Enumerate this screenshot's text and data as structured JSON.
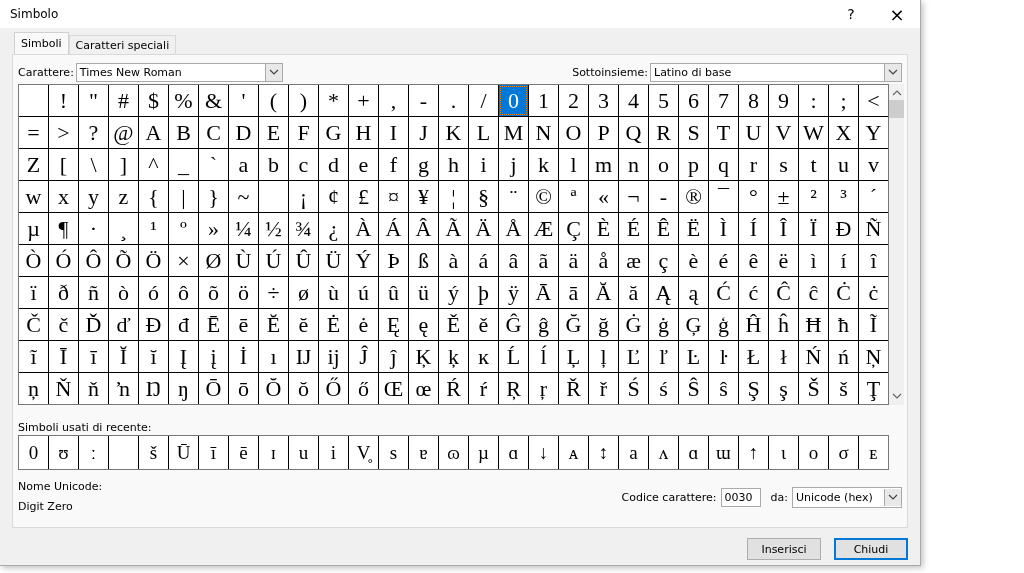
{
  "window": {
    "title": "Simbolo",
    "help": "?",
    "close": "×"
  },
  "tabs": [
    {
      "label": "Simboli",
      "selected": true
    },
    {
      "label": "Caratteri speciali",
      "selected": false
    }
  ],
  "font": {
    "label": "Carattere:",
    "value": "Times New Roman"
  },
  "subset": {
    "label": "Sottoinsieme:",
    "value": "Latino di base"
  },
  "grid": {
    "rows": [
      [
        {
          "selected": false
        },
        {
          "c": "!",
          "selected": false
        },
        {
          "c": "\"",
          "selected": false
        },
        {
          "c": "#",
          "selected": false
        },
        {
          "c": "$",
          "selected": false
        },
        {
          "c": "%",
          "selected": false
        },
        {
          "c": "&",
          "selected": false
        },
        {
          "c": "'",
          "selected": false
        },
        {
          "c": "(",
          "selected": false
        },
        {
          "c": ")",
          "selected": false
        },
        {
          "c": "*",
          "selected": false
        },
        {
          "c": "+",
          "selected": false
        },
        {
          "c": ",",
          "selected": false
        },
        {
          "c": "-",
          "selected": false
        },
        {
          "c": ".",
          "selected": false
        },
        {
          "c": "/",
          "selected": false
        },
        {
          "c": "0",
          "selected": true
        },
        {
          "c": "1",
          "selected": false
        },
        {
          "c": "2",
          "selected": false
        },
        {
          "c": "3",
          "selected": false
        },
        {
          "c": "4",
          "selected": false
        },
        {
          "c": "5",
          "selected": false
        },
        {
          "c": "6",
          "selected": false
        },
        {
          "c": "7",
          "selected": false
        },
        {
          "c": "8",
          "selected": false
        },
        {
          "c": "9",
          "selected": false
        },
        {
          "c": ":",
          "selected": false
        },
        {
          "c": ";",
          "selected": false
        },
        {
          "c": "<",
          "selected": false
        }
      ],
      [
        {
          "c": "=",
          "selected": false
        },
        {
          "c": ">",
          "selected": false
        },
        {
          "c": "?",
          "selected": false
        },
        {
          "c": "@",
          "selected": false
        },
        {
          "c": "A",
          "selected": false
        },
        {
          "c": "B",
          "selected": false
        },
        {
          "c": "C",
          "selected": false
        },
        {
          "c": "D",
          "selected": false
        },
        {
          "c": "E",
          "selected": false
        },
        {
          "c": "F",
          "selected": false
        },
        {
          "c": "G",
          "selected": false
        },
        {
          "c": "H",
          "selected": false
        },
        {
          "c": "I",
          "selected": false
        },
        {
          "c": "J",
          "selected": false
        },
        {
          "c": "K",
          "selected": false
        },
        {
          "c": "L",
          "selected": false
        },
        {
          "c": "M",
          "selected": false
        },
        {
          "c": "N",
          "selected": false
        },
        {
          "c": "O",
          "selected": false
        },
        {
          "c": "P",
          "selected": false
        },
        {
          "c": "Q",
          "selected": false
        },
        {
          "c": "R",
          "selected": false
        },
        {
          "c": "S",
          "selected": false
        },
        {
          "c": "T",
          "selected": false
        },
        {
          "c": "U",
          "selected": false
        },
        {
          "c": "V",
          "selected": false
        },
        {
          "c": "W",
          "selected": false
        },
        {
          "c": "X",
          "selected": false
        },
        {
          "c": "Y",
          "selected": false
        }
      ],
      [
        {
          "c": "Z",
          "selected": false
        },
        {
          "c": "[",
          "selected": false
        },
        {
          "c": "\\",
          "selected": false
        },
        {
          "c": "]",
          "selected": false
        },
        {
          "c": "^",
          "selected": false
        },
        {
          "c": "_",
          "selected": false
        },
        {
          "c": "`",
          "selected": false
        },
        {
          "c": "a",
          "selected": false
        },
        {
          "c": "b",
          "selected": false
        },
        {
          "c": "c",
          "selected": false
        },
        {
          "c": "d",
          "selected": false
        },
        {
          "c": "e",
          "selected": false
        },
        {
          "c": "f",
          "selected": false
        },
        {
          "c": "g",
          "selected": false
        },
        {
          "c": "h",
          "selected": false
        },
        {
          "c": "i",
          "selected": false
        },
        {
          "c": "j",
          "selected": false
        },
        {
          "c": "k",
          "selected": false
        },
        {
          "c": "l",
          "selected": false
        },
        {
          "c": "m",
          "selected": false
        },
        {
          "c": "n",
          "selected": false
        },
        {
          "c": "o",
          "selected": false
        },
        {
          "c": "p",
          "selected": false
        },
        {
          "c": "q",
          "selected": false
        },
        {
          "c": "r",
          "selected": false
        },
        {
          "c": "s",
          "selected": false
        },
        {
          "c": "t",
          "selected": false
        },
        {
          "c": "u",
          "selected": false
        },
        {
          "c": "v",
          "selected": false
        }
      ],
      [
        {
          "c": "w",
          "selected": false
        },
        {
          "c": "x",
          "selected": false
        },
        {
          "c": "y",
          "selected": false
        },
        {
          "c": "z",
          "selected": false
        },
        {
          "c": "{",
          "selected": false
        },
        {
          "c": "|",
          "selected": false
        },
        {
          "c": "}",
          "selected": false
        },
        {
          "c": "~",
          "selected": false
        },
        {
          "selected": false
        },
        {
          "c": "¡",
          "selected": false
        },
        {
          "c": "¢",
          "selected": false
        },
        {
          "c": "£",
          "selected": false
        },
        {
          "c": "¤",
          "selected": false
        },
        {
          "c": "¥",
          "selected": false
        },
        {
          "c": "¦",
          "selected": false
        },
        {
          "c": "§",
          "selected": false
        },
        {
          "c": "¨",
          "selected": false
        },
        {
          "c": "©",
          "selected": false
        },
        {
          "c": "ª",
          "selected": false
        },
        {
          "c": "«",
          "selected": false
        },
        {
          "c": "¬",
          "selected": false
        },
        {
          "c": "-",
          "selected": false
        },
        {
          "c": "®",
          "selected": false
        },
        {
          "c": "¯",
          "selected": false
        },
        {
          "c": "°",
          "selected": false
        },
        {
          "c": "±",
          "selected": false
        },
        {
          "c": "²",
          "selected": false
        },
        {
          "c": "³",
          "selected": false
        },
        {
          "c": "´",
          "selected": false
        }
      ],
      [
        {
          "c": "µ",
          "selected": false
        },
        {
          "c": "¶",
          "selected": false
        },
        {
          "c": "·",
          "selected": false
        },
        {
          "c": "¸",
          "selected": false
        },
        {
          "c": "¹",
          "selected": false
        },
        {
          "c": "º",
          "selected": false
        },
        {
          "c": "»",
          "selected": false
        },
        {
          "c": "¼",
          "selected": false
        },
        {
          "c": "½",
          "selected": false
        },
        {
          "c": "¾",
          "selected": false
        },
        {
          "c": "¿",
          "selected": false
        },
        {
          "c": "À",
          "selected": false
        },
        {
          "c": "Á",
          "selected": false
        },
        {
          "c": "Â",
          "selected": false
        },
        {
          "c": "Ã",
          "selected": false
        },
        {
          "c": "Ä",
          "selected": false
        },
        {
          "c": "Å",
          "selected": false
        },
        {
          "c": "Æ",
          "selected": false
        },
        {
          "c": "Ç",
          "selected": false
        },
        {
          "c": "È",
          "selected": false
        },
        {
          "c": "É",
          "selected": false
        },
        {
          "c": "Ê",
          "selected": false
        },
        {
          "c": "Ë",
          "selected": false
        },
        {
          "c": "Ì",
          "selected": false
        },
        {
          "c": "Í",
          "selected": false
        },
        {
          "c": "Î",
          "selected": false
        },
        {
          "c": "Ï",
          "selected": false
        },
        {
          "c": "Ð",
          "selected": false
        },
        {
          "c": "Ñ",
          "selected": false
        }
      ],
      [
        {
          "c": "Ò",
          "selected": false
        },
        {
          "c": "Ó",
          "selected": false
        },
        {
          "c": "Ô",
          "selected": false
        },
        {
          "c": "Õ",
          "selected": false
        },
        {
          "c": "Ö",
          "selected": false
        },
        {
          "c": "×",
          "selected": false
        },
        {
          "c": "Ø",
          "selected": false
        },
        {
          "c": "Ù",
          "selected": false
        },
        {
          "c": "Ú",
          "selected": false
        },
        {
          "c": "Û",
          "selected": false
        },
        {
          "c": "Ü",
          "selected": false
        },
        {
          "c": "Ý",
          "selected": false
        },
        {
          "c": "Þ",
          "selected": false
        },
        {
          "c": "ß",
          "selected": false
        },
        {
          "c": "à",
          "selected": false
        },
        {
          "c": "á",
          "selected": false
        },
        {
          "c": "â",
          "selected": false
        },
        {
          "c": "ã",
          "selected": false
        },
        {
          "c": "ä",
          "selected": false
        },
        {
          "c": "å",
          "selected": false
        },
        {
          "c": "æ",
          "selected": false
        },
        {
          "c": "ç",
          "selected": false
        },
        {
          "c": "è",
          "selected": false
        },
        {
          "c": "é",
          "selected": false
        },
        {
          "c": "ê",
          "selected": false
        },
        {
          "c": "ë",
          "selected": false
        },
        {
          "c": "ì",
          "selected": false
        },
        {
          "c": "í",
          "selected": false
        },
        {
          "c": "î",
          "selected": false
        }
      ],
      [
        {
          "c": "ï",
          "selected": false
        },
        {
          "c": "ð",
          "selected": false
        },
        {
          "c": "ñ",
          "selected": false
        },
        {
          "c": "ò",
          "selected": false
        },
        {
          "c": "ó",
          "selected": false
        },
        {
          "c": "ô",
          "selected": false
        },
        {
          "c": "õ",
          "selected": false
        },
        {
          "c": "ö",
          "selected": false
        },
        {
          "c": "÷",
          "selected": false
        },
        {
          "c": "ø",
          "selected": false
        },
        {
          "c": "ù",
          "selected": false
        },
        {
          "c": "ú",
          "selected": false
        },
        {
          "c": "û",
          "selected": false
        },
        {
          "c": "ü",
          "selected": false
        },
        {
          "c": "ý",
          "selected": false
        },
        {
          "c": "þ",
          "selected": false
        },
        {
          "c": "ÿ",
          "selected": false
        },
        {
          "c": "Ā",
          "selected": false
        },
        {
          "c": "ā",
          "selected": false
        },
        {
          "c": "Ă",
          "selected": false
        },
        {
          "c": "ă",
          "selected": false
        },
        {
          "c": "Ą",
          "selected": false
        },
        {
          "c": "ą",
          "selected": false
        },
        {
          "c": "Ć",
          "selected": false
        },
        {
          "c": "ć",
          "selected": false
        },
        {
          "c": "Ĉ",
          "selected": false
        },
        {
          "c": "ĉ",
          "selected": false
        },
        {
          "c": "Ċ",
          "selected": false
        },
        {
          "c": "ċ",
          "selected": false
        }
      ],
      [
        {
          "c": "Č",
          "selected": false
        },
        {
          "c": "č",
          "selected": false
        },
        {
          "c": "Ď",
          "selected": false
        },
        {
          "c": "ď",
          "selected": false
        },
        {
          "c": "Đ",
          "selected": false
        },
        {
          "c": "đ",
          "selected": false
        },
        {
          "c": "Ē",
          "selected": false
        },
        {
          "c": "ē",
          "selected": false
        },
        {
          "c": "Ĕ",
          "selected": false
        },
        {
          "c": "ĕ",
          "selected": false
        },
        {
          "c": "Ė",
          "selected": false
        },
        {
          "c": "ė",
          "selected": false
        },
        {
          "c": "Ę",
          "selected": false
        },
        {
          "c": "ę",
          "selected": false
        },
        {
          "c": "Ě",
          "selected": false
        },
        {
          "c": "ě",
          "selected": false
        },
        {
          "c": "Ĝ",
          "selected": false
        },
        {
          "c": "ĝ",
          "selected": false
        },
        {
          "c": "Ğ",
          "selected": false
        },
        {
          "c": "ğ",
          "selected": false
        },
        {
          "c": "Ġ",
          "selected": false
        },
        {
          "c": "ġ",
          "selected": false
        },
        {
          "c": "Ģ",
          "selected": false
        },
        {
          "c": "ģ",
          "selected": false
        },
        {
          "c": "Ĥ",
          "selected": false
        },
        {
          "c": "ĥ",
          "selected": false
        },
        {
          "c": "Ħ",
          "selected": false
        },
        {
          "c": "ħ",
          "selected": false
        },
        {
          "c": "Ĩ",
          "selected": false
        }
      ],
      [
        {
          "c": "ĩ",
          "selected": false
        },
        {
          "c": "Ī",
          "selected": false
        },
        {
          "c": "ī",
          "selected": false
        },
        {
          "c": "Ĭ",
          "selected": false
        },
        {
          "c": "ĭ",
          "selected": false
        },
        {
          "c": "Į",
          "selected": false
        },
        {
          "c": "į",
          "selected": false
        },
        {
          "c": "İ",
          "selected": false
        },
        {
          "c": "ı",
          "selected": false
        },
        {
          "c": "Ĳ",
          "selected": false
        },
        {
          "c": "ĳ",
          "selected": false
        },
        {
          "c": "Ĵ",
          "selected": false
        },
        {
          "c": "ĵ",
          "selected": false
        },
        {
          "c": "Ķ",
          "selected": false
        },
        {
          "c": "ķ",
          "selected": false
        },
        {
          "c": "ĸ",
          "selected": false
        },
        {
          "c": "Ĺ",
          "selected": false
        },
        {
          "c": "ĺ",
          "selected": false
        },
        {
          "c": "Ļ",
          "selected": false
        },
        {
          "c": "ļ",
          "selected": false
        },
        {
          "c": "Ľ",
          "selected": false
        },
        {
          "c": "ľ",
          "selected": false
        },
        {
          "c": "Ŀ",
          "selected": false
        },
        {
          "c": "ŀ",
          "selected": false
        },
        {
          "c": "Ł",
          "selected": false
        },
        {
          "c": "ł",
          "selected": false
        },
        {
          "c": "Ń",
          "selected": false
        },
        {
          "c": "ń",
          "selected": false
        },
        {
          "c": "Ņ",
          "selected": false
        }
      ],
      [
        {
          "c": "ņ",
          "selected": false
        },
        {
          "c": "Ň",
          "selected": false
        },
        {
          "c": "ň",
          "selected": false
        },
        {
          "c": "ŉ",
          "selected": false
        },
        {
          "c": "Ŋ",
          "selected": false
        },
        {
          "c": "ŋ",
          "selected": false
        },
        {
          "c": "Ō",
          "selected": false
        },
        {
          "c": "ō",
          "selected": false
        },
        {
          "c": "Ŏ",
          "selected": false
        },
        {
          "c": "ŏ",
          "selected": false
        },
        {
          "c": "Ő",
          "selected": false
        },
        {
          "c": "ő",
          "selected": false
        },
        {
          "c": "Œ",
          "selected": false
        },
        {
          "c": "œ",
          "selected": false
        },
        {
          "c": "Ŕ",
          "selected": false
        },
        {
          "c": "ŕ",
          "selected": false
        },
        {
          "c": "Ŗ",
          "selected": false
        },
        {
          "c": "ŗ",
          "selected": false
        },
        {
          "c": "Ř",
          "selected": false
        },
        {
          "c": "ř",
          "selected": false
        },
        {
          "c": "Ś",
          "selected": false
        },
        {
          "c": "ś",
          "selected": false
        },
        {
          "c": "Ŝ",
          "selected": false
        },
        {
          "c": "ŝ",
          "selected": false
        },
        {
          "c": "Ş",
          "selected": false
        },
        {
          "c": "ş",
          "selected": false
        },
        {
          "c": "Š",
          "selected": false
        },
        {
          "c": "š",
          "selected": false
        },
        {
          "c": "Ţ",
          "selected": false
        }
      ]
    ]
  },
  "recent": {
    "label": "Simboli usati di recente:",
    "symbols": [
      {
        "c": "0",
        "selected": false
      },
      {
        "c": "ʊ",
        "selected": false
      },
      {
        "c": "ː",
        "selected": false
      },
      {
        "selected": false
      },
      {
        "c": "š",
        "selected": false
      },
      {
        "c": "Ū",
        "selected": false
      },
      {
        "c": "ī",
        "selected": false
      },
      {
        "c": "ē",
        "selected": false
      },
      {
        "c": "ɪ",
        "selected": false
      },
      {
        "c": "u",
        "selected": false
      },
      {
        "c": "i",
        "selected": false
      },
      {
        "c": "V̥",
        "selected": false
      },
      {
        "c": "s",
        "selected": false
      },
      {
        "c": "ɐ",
        "selected": false
      },
      {
        "c": "ɷ",
        "selected": false
      },
      {
        "c": "µ",
        "selected": false
      },
      {
        "c": "ɑ",
        "selected": false
      },
      {
        "c": "↓",
        "selected": false
      },
      {
        "c": "ᴀ",
        "selected": false
      },
      {
        "c": "↕",
        "selected": false
      },
      {
        "c": "a",
        "selected": false
      },
      {
        "c": "ʌ",
        "selected": false
      },
      {
        "c": "ɑ",
        "selected": false
      },
      {
        "c": "ɯ",
        "selected": false
      },
      {
        "c": "↑",
        "selected": false
      },
      {
        "c": "ɩ",
        "selected": false
      },
      {
        "c": "o",
        "selected": false
      },
      {
        "c": "σ",
        "selected": false
      },
      {
        "c": "ᴇ",
        "selected": false
      }
    ]
  },
  "unicode_name": {
    "label": "Nome Unicode:",
    "value": "Digit Zero"
  },
  "char_code": {
    "label": "Codice carattere:",
    "value": "0030"
  },
  "from": {
    "label": "da:",
    "value": "Unicode (hex)"
  },
  "buttons": [
    {
      "label": "Inserisci",
      "default": false
    },
    {
      "label": "Chiudi",
      "default": true
    }
  ]
}
